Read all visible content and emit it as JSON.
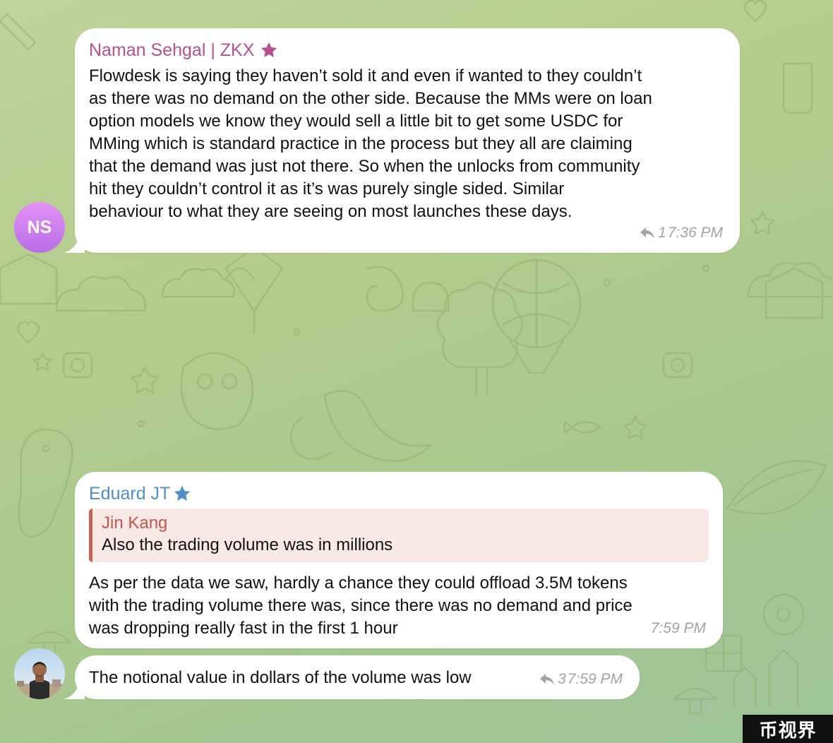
{
  "messages": [
    {
      "sender": "Naman Sehgal | ZKX",
      "sender_color": "#b8508f",
      "avatar_initials": "NS",
      "text": "Flowdesk is saying they haven’t sold it and even if wanted to they couldn’t\nas there was no demand on the other side. Because the MMs were on loan\noption models we know they would sell a little bit to get some USDC for\nMMing which is standard practice in the process but they all are claiming\nthat the demand was just not there. So when the unlocks from community\nhit they couldn’t control it as it’s was purely single sided. Similar\nbehaviour to what they are seeing on most launches these days.",
      "reply_count": "1",
      "time": "7:36 PM"
    },
    {
      "sender": "Eduard JT",
      "sender_color": "#4f8ec7",
      "quote": {
        "author": "Jin Kang",
        "text": "Also the trading volume was in millions"
      },
      "text": "As per the data we saw, hardly a chance they could offload 3.5M tokens\nwith the trading volume there was, since there was no demand and price\nwas dropping really fast in the first 1 hour",
      "time": "7:59 PM"
    },
    {
      "text": "The notional value in dollars of the volume was low",
      "reply_count": "3",
      "time": "7:59 PM"
    }
  ],
  "watermark": "币视界"
}
